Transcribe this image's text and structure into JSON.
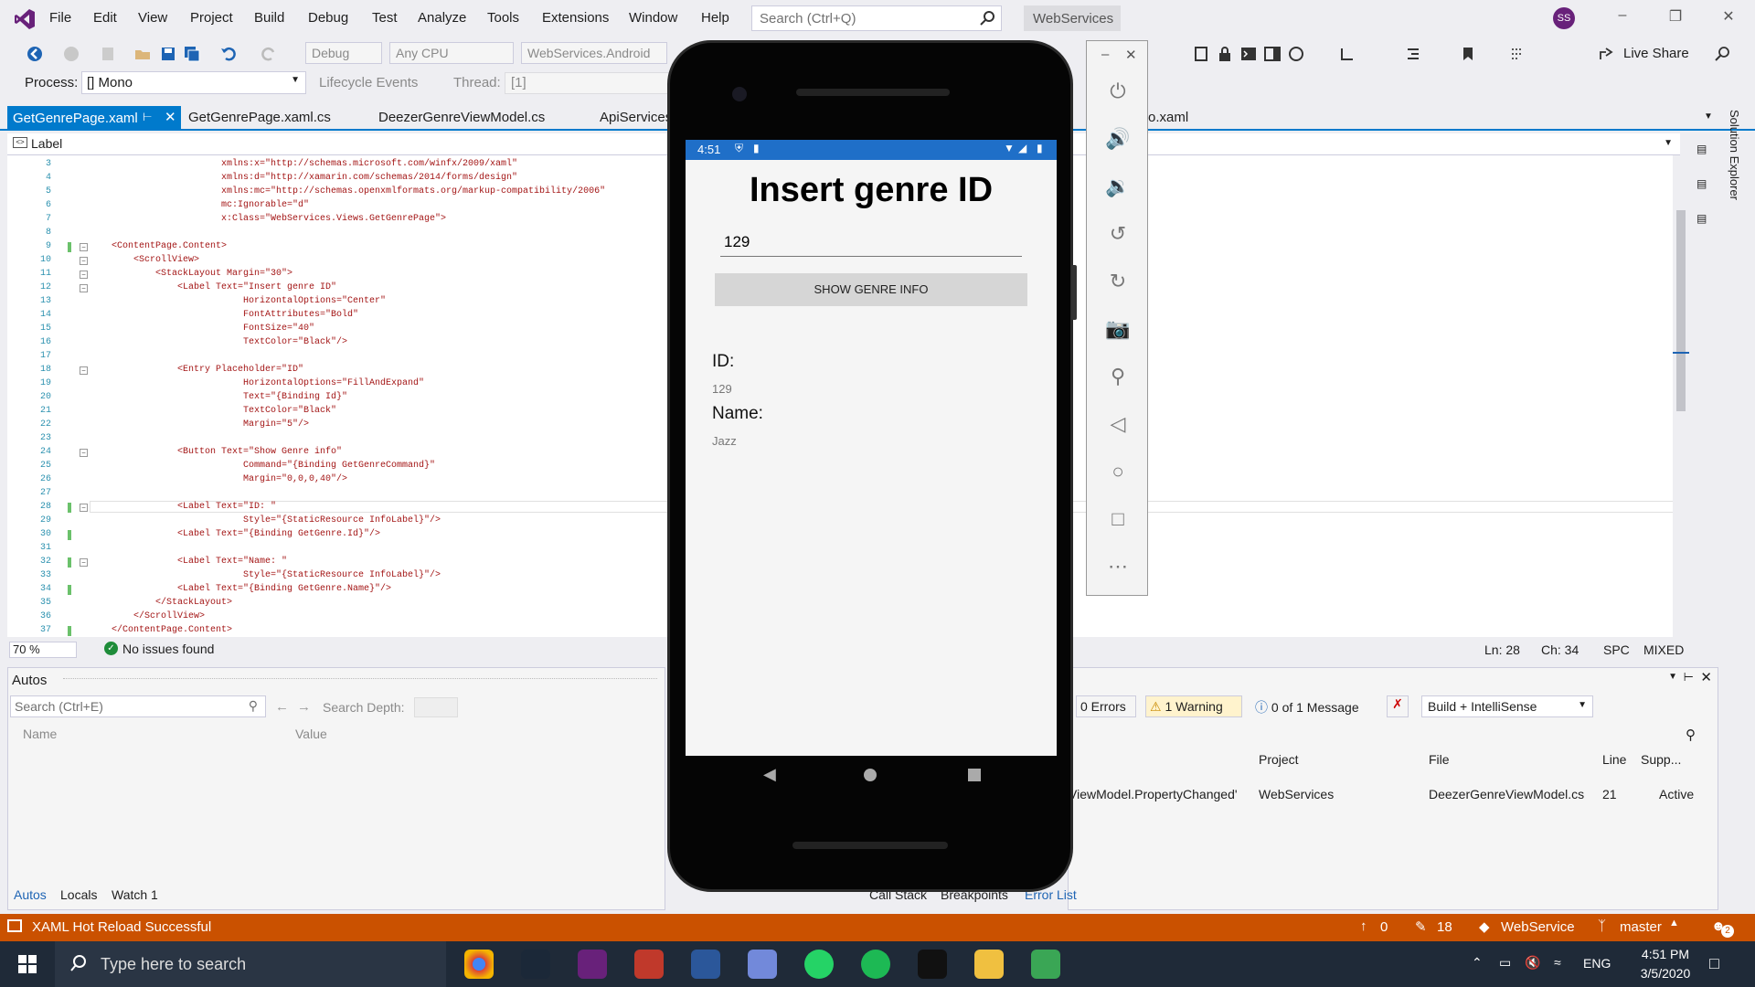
{
  "menu": [
    "File",
    "Edit",
    "View",
    "Project",
    "Build",
    "Debug",
    "Test",
    "Analyze",
    "Tools",
    "Extensions",
    "Window",
    "Help"
  ],
  "search": {
    "placeholder": "Search (Ctrl+Q)"
  },
  "window_title": "WebServices",
  "user_initials": "SS",
  "toolbar": {
    "config": "Debug",
    "platform": "Any CPU",
    "startup": "WebServices.Android",
    "live_share": "Live Share"
  },
  "process": {
    "label": "Process:",
    "value": "[] Mono",
    "lifecycle": "Lifecycle Events",
    "thread_label": "Thread:",
    "thread_value": "[1]"
  },
  "tabs": [
    "GetGenrePage.xaml",
    "GetGenrePage.xaml.cs",
    "DeezerGenreViewModel.cs",
    "ApiServices",
    "o.xaml"
  ],
  "navbar_label": "Label",
  "code_lines": [
    {
      "n": "3",
      "text": "xmlns:x=\"http://schemas.microsoft.com/winfx/2009/xaml\"",
      "indent": 5
    },
    {
      "n": "4",
      "text": "xmlns:d=\"http://xamarin.com/schemas/2014/forms/design\"",
      "indent": 5
    },
    {
      "n": "5",
      "text": "xmlns:mc=\"http://schemas.openxmlformats.org/markup-compatibility/2006\"",
      "indent": 5
    },
    {
      "n": "6",
      "text": "mc:Ignorable=\"d\"",
      "indent": 5
    },
    {
      "n": "7",
      "text": "x:Class=\"WebServices.Views.GetGenrePage\">",
      "indent": 5
    },
    {
      "n": "8",
      "text": "",
      "indent": 0
    },
    {
      "n": "9",
      "text": "<ContentPage.Content>",
      "indent": 0
    },
    {
      "n": "10",
      "text": "<ScrollView>",
      "indent": 1
    },
    {
      "n": "11",
      "text": "<StackLayout Margin=\"30\">",
      "indent": 2
    },
    {
      "n": "12",
      "text": "<Label Text=\"Insert genre ID\"",
      "indent": 3
    },
    {
      "n": "13",
      "text": "HorizontalOptions=\"Center\"",
      "indent": 6
    },
    {
      "n": "14",
      "text": "FontAttributes=\"Bold\"",
      "indent": 6
    },
    {
      "n": "15",
      "text": "FontSize=\"40\"",
      "indent": 6
    },
    {
      "n": "16",
      "text": "TextColor=\"Black\"/>",
      "indent": 6
    },
    {
      "n": "17",
      "text": "",
      "indent": 0
    },
    {
      "n": "18",
      "text": "<Entry Placeholder=\"ID\"",
      "indent": 3
    },
    {
      "n": "19",
      "text": "HorizontalOptions=\"FillAndExpand\"",
      "indent": 6
    },
    {
      "n": "20",
      "text": "Text=\"{Binding Id}\"",
      "indent": 6
    },
    {
      "n": "21",
      "text": "TextColor=\"Black\"",
      "indent": 6
    },
    {
      "n": "22",
      "text": "Margin=\"5\"/>",
      "indent": 6
    },
    {
      "n": "23",
      "text": "",
      "indent": 0
    },
    {
      "n": "24",
      "text": "<Button Text=\"Show Genre info\"",
      "indent": 3
    },
    {
      "n": "25",
      "text": "Command=\"{Binding GetGenreCommand}\"",
      "indent": 6
    },
    {
      "n": "26",
      "text": "Margin=\"0,0,0,40\"/>",
      "indent": 6
    },
    {
      "n": "27",
      "text": "",
      "indent": 0
    },
    {
      "n": "28",
      "text": "<Label Text=\"ID: \"",
      "indent": 3
    },
    {
      "n": "29",
      "text": "Style=\"{StaticResource InfoLabel}\"/>",
      "indent": 6
    },
    {
      "n": "30",
      "text": "<Label Text=\"{Binding GetGenre.Id}\"/>",
      "indent": 3
    },
    {
      "n": "31",
      "text": "",
      "indent": 0
    },
    {
      "n": "32",
      "text": "<Label Text=\"Name: \"",
      "indent": 3
    },
    {
      "n": "33",
      "text": "Style=\"{StaticResource InfoLabel}\"/>",
      "indent": 6
    },
    {
      "n": "34",
      "text": "<Label Text=\"{Binding GetGenre.Name}\"/>",
      "indent": 3
    },
    {
      "n": "35",
      "text": "</StackLayout>",
      "indent": 2
    },
    {
      "n": "36",
      "text": "</ScrollView>",
      "indent": 1
    },
    {
      "n": "37",
      "text": "</ContentPage.Content>",
      "indent": 0
    }
  ],
  "editor_status": {
    "zoom": "70 %",
    "issues": "No issues found",
    "ln": "Ln: 28",
    "ch": "Ch: 34",
    "spc": "SPC",
    "mixed": "MIXED"
  },
  "autos": {
    "title": "Autos",
    "search_placeholder": "Search (Ctrl+E)",
    "search_depth": "Search Depth:",
    "col_name": "Name",
    "col_value": "Value"
  },
  "errorlist": {
    "errors": "0 Errors",
    "warnings": "1 Warning",
    "messages": "0 of 1 Message",
    "filter": "Build + IntelliSense",
    "col_project": "Project",
    "col_file": "File",
    "col_line": "Line",
    "col_supp": "Supp...",
    "row": {
      "desc": "ViewModel.PropertyChanged'",
      "project": "WebServices",
      "file": "DeezerGenreViewModel.cs",
      "line": "21",
      "supp": "Active"
    }
  },
  "bottom_tabs_left": [
    "Autos",
    "Locals",
    "Watch 1"
  ],
  "bottom_tabs_right": [
    "Call Stack",
    "Breakpoints",
    "Error List"
  ],
  "statusbar": {
    "message": "XAML Hot Reload Successful",
    "up": "0",
    "pencil": "18",
    "repo": "WebService",
    "branch": "master",
    "notif": "2"
  },
  "taskbar": {
    "search_placeholder": "Type here to search",
    "lang": "ENG",
    "time": "4:51 PM",
    "date": "3/5/2020"
  },
  "phone": {
    "time": "4:51",
    "title": "Insert genre ID",
    "entry_value": "129",
    "button": "SHOW GENRE INFO",
    "id_label": "ID:",
    "id_value": "129",
    "name_label": "Name:",
    "name_value": "Jazz"
  },
  "colors": {
    "accent": "#007acc",
    "status": "#ca5100",
    "phone_bar": "#1f6fc8"
  }
}
